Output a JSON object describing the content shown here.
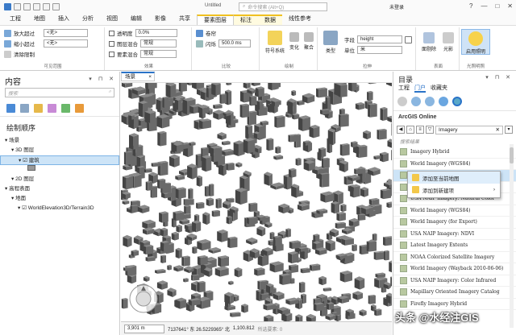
{
  "app": {
    "doc_title": "Untitled",
    "command_search_placeholder": "命令搜索 (Alt+Q)",
    "user": "未登录",
    "win_controls": [
      "?",
      "—",
      "□",
      "✕"
    ]
  },
  "menu": {
    "tabs": [
      "工程",
      "地图",
      "插入",
      "分析",
      "视图",
      "编辑",
      "影像",
      "共享",
      "要素图层",
      "标注",
      "数据",
      "线性参考"
    ],
    "active": "要素图层"
  },
  "ribbon": {
    "visibility": {
      "label": "可见范围",
      "zoom_in": "放大超过",
      "zoom_out": "缩小超过",
      "clear": "清除限制",
      "in_value": "<无>",
      "out_value": "<无>"
    },
    "effects": {
      "label": "效果",
      "transparency": "透明度",
      "transparency_value": "0.0%",
      "blend": "图层混合",
      "blend_value": "常规",
      "feature_blend": "要素混合",
      "feature_blend_value": "常规"
    },
    "compare": {
      "label": "比较",
      "swipe": "卷帘",
      "lighting": "闪烁",
      "lighting_value": "500.0 ms"
    },
    "drawing": {
      "label": "绘制",
      "symbology": "符号系统",
      "vary": "变化",
      "aggregate": "聚合"
    },
    "extrusion": {
      "label": "拉伸",
      "type": "类型",
      "type_value": "",
      "field": "字段",
      "field_value": "height",
      "unit": "单位",
      "unit_value": "米"
    },
    "faces": {
      "label": "表面",
      "face_culling": "面剔除",
      "lighting": "光影"
    },
    "illumination": {
      "label": "光照明照",
      "btn": "启用照明"
    }
  },
  "contents": {
    "title": "内容",
    "search_placeholder": "搜索",
    "drawing_order": "绘制顺序",
    "items": [
      {
        "label": "场景",
        "indent": 0,
        "checkbox": false
      },
      {
        "label": "3D 图层",
        "indent": 1,
        "checkbox": false
      },
      {
        "label": "建筑",
        "indent": 2,
        "checkbox": true,
        "selected": true
      },
      {
        "label": "",
        "indent": 3,
        "checkbox": false
      },
      {
        "label": "2D 图层",
        "indent": 1,
        "checkbox": false
      },
      {
        "label": "高程表面",
        "indent": 0,
        "checkbox": false
      },
      {
        "label": "地面",
        "indent": 1,
        "checkbox": false
      },
      {
        "label": "WorldElevation3D/Terrain3D",
        "indent": 2,
        "checkbox": true
      }
    ]
  },
  "map": {
    "tab_label": "场景",
    "status": {
      "scale": "3,901 m",
      "coords": "7137641° 东 26.5229365° 北",
      "elev": "1,100.812",
      "selected": "所选要素: 0"
    }
  },
  "catalog": {
    "title": "目录",
    "tabs": [
      "工程",
      "门户",
      "收藏夹"
    ],
    "active_tab": "门户",
    "section": "ArcGIS Online",
    "filter": "Imagery",
    "results_label": "搜索结果",
    "results": [
      "Imagery Hybrid",
      "World Imagery (WGS84)",
      "World Imagery",
      "World Imagery (Clarity Beta)",
      "USA NAIP Imagery: Natural Color",
      "World Imagery (WGS84)",
      "World Imagery (for Export)",
      "USA NAIP Imagery: NDVI",
      "Latest Imagery Extents",
      "NOAA Colorized Satellite Imagery",
      "World Imagery (Wayback 2010-06-06)",
      "USA NAIP Imagery: Color Infrared",
      "Mapillary Oriented Imagery Catalog",
      "Firefly Imagery Hybrid"
    ],
    "selected_index": 2,
    "context_menu": [
      {
        "label": "添加至当前地图",
        "submenu": false
      },
      {
        "label": "添加到新建项",
        "submenu": true
      }
    ]
  },
  "watermark": "头条 @水经注GIS",
  "colors": {
    "accent": "#2a73c8",
    "context_tab": "#f0c020",
    "selection": "#cde4f7"
  }
}
